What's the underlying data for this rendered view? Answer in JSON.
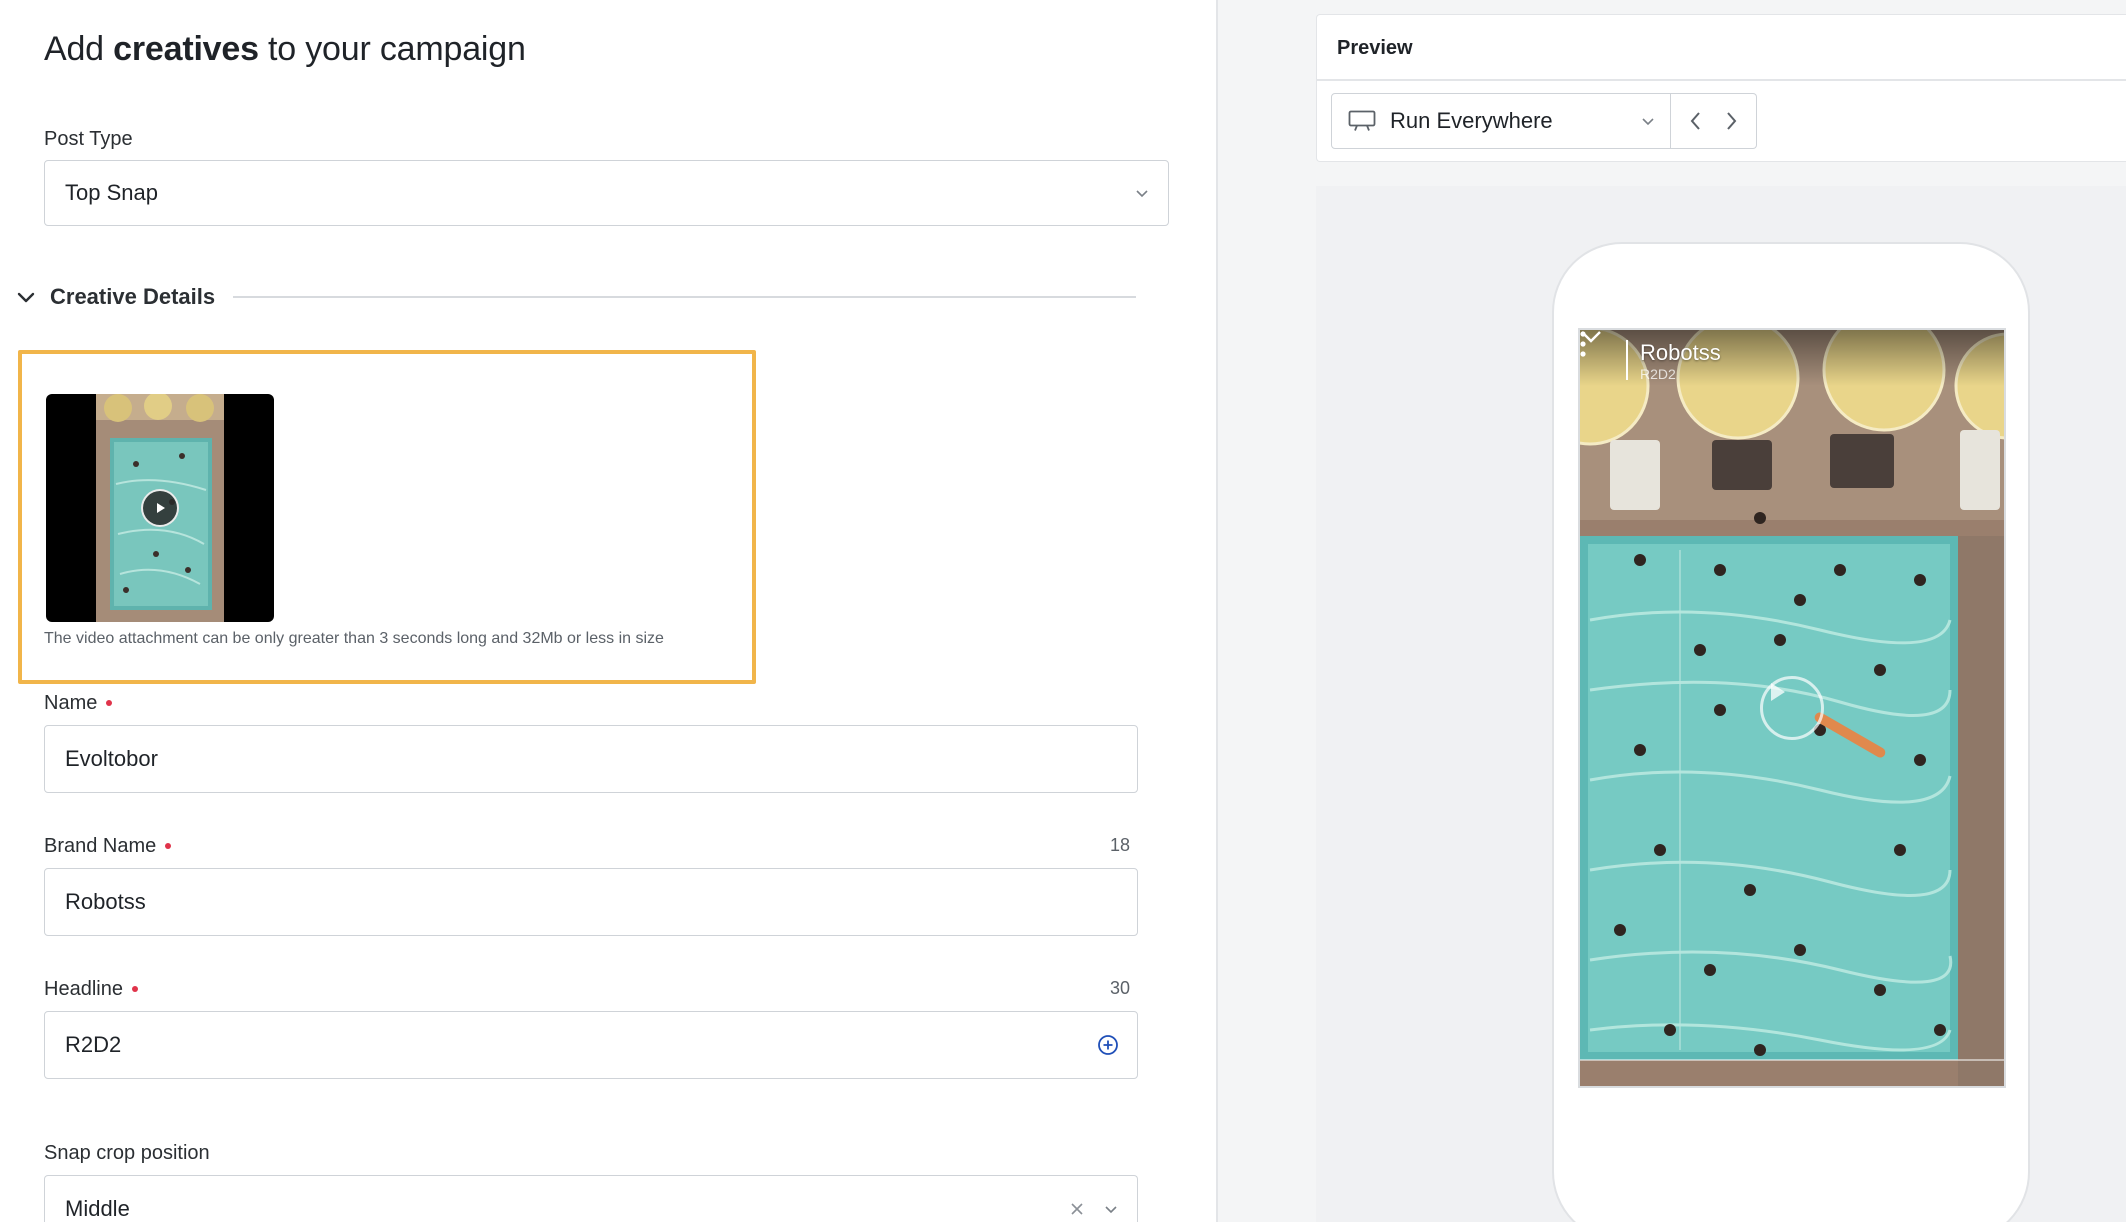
{
  "page": {
    "title_prefix": "Add ",
    "title_bold": "creatives",
    "title_suffix": " to your campaign"
  },
  "post_type": {
    "label": "Post Type",
    "value": "Top Snap"
  },
  "creative_details": {
    "title": "Creative Details",
    "upload_hint": "The video attachment can be only greater than 3 seconds long and 32Mb or less in size"
  },
  "name_field": {
    "label": "Name",
    "value": "Evoltobor"
  },
  "brand_field": {
    "label": "Brand Name",
    "counter": "18",
    "value": "Robotss"
  },
  "headline_field": {
    "label": "Headline",
    "counter": "30",
    "value": "R2D2"
  },
  "crop_field": {
    "label": "Snap crop position",
    "value": "Middle"
  },
  "preview": {
    "title": "Preview",
    "placement": "Run Everywhere",
    "snap_brand": "Robotss",
    "snap_headline": "R2D2"
  },
  "colors": {
    "highlight_border": "#f1b54a",
    "required_dot": "#e0334a",
    "accent_blue": "#1f4fb8"
  },
  "icons": {
    "collapse": "chevron-down-icon",
    "video_play": "play-icon",
    "headline_add": "add-circle-icon",
    "placement": "monitor-icon",
    "prev": "chevron-left-icon",
    "next": "chevron-right-icon",
    "clear": "close-icon",
    "snap_more": "more-vertical-icon"
  }
}
